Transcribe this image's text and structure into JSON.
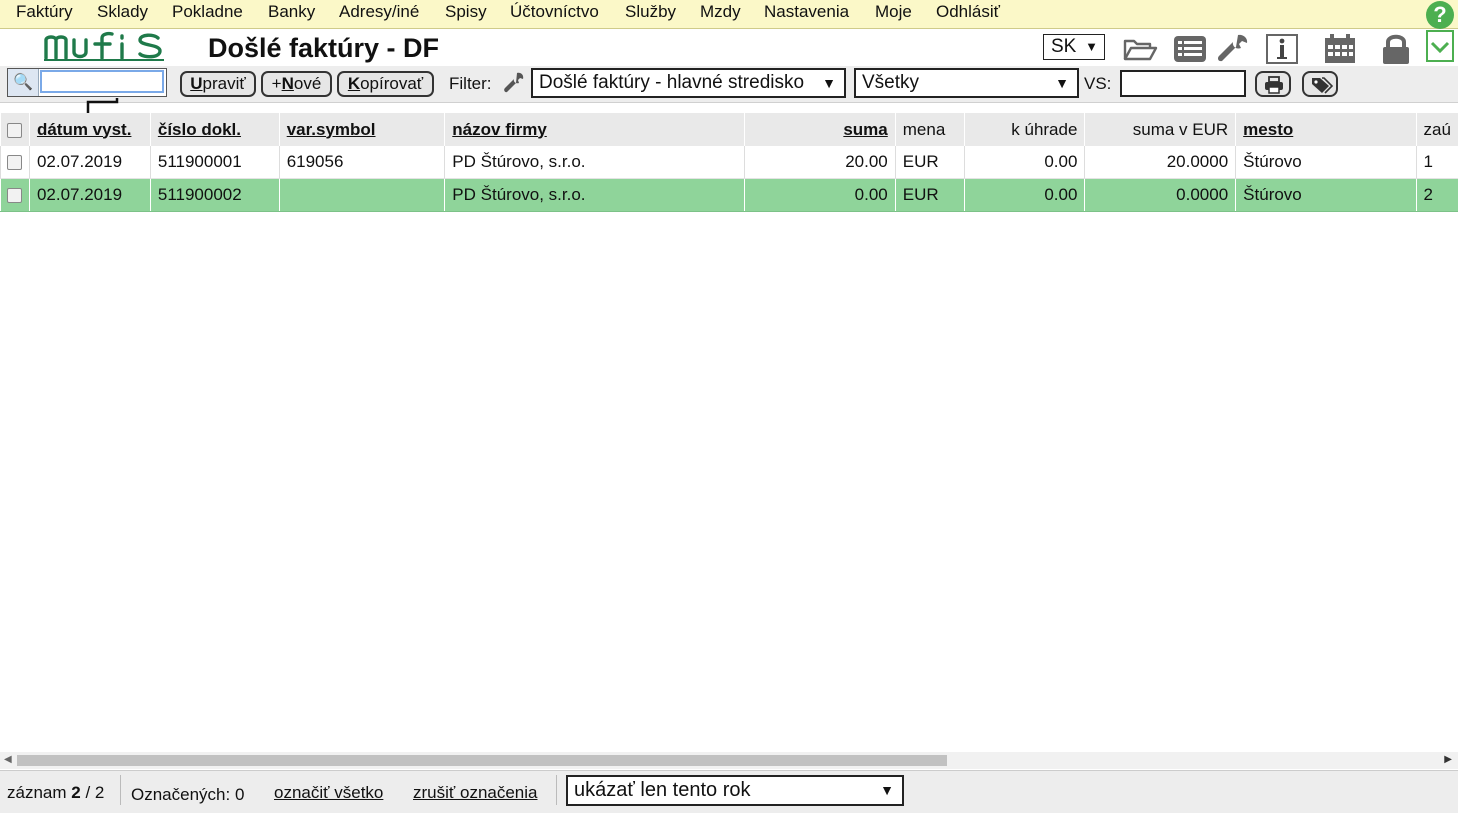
{
  "menu": {
    "items": [
      "Faktúry",
      "Sklady",
      "Pokladne",
      "Banky",
      "Adresy/iné",
      "Spisy",
      "Účtovníctvo",
      "Služby",
      "Mzdy",
      "Nastavenia",
      "Moje",
      "Odhlásiť"
    ],
    "help": "?"
  },
  "header": {
    "title": "Došlé faktúry - DF",
    "language": "SK",
    "icons": [
      "folder-icon",
      "list-icon",
      "wrench-icon",
      "info-icon",
      "calendar-icon",
      "lock-icon"
    ]
  },
  "toolbar": {
    "search_value": "",
    "edit_hotkey": "U",
    "edit_rest": "praviť",
    "new_prefix": "+",
    "new_hotkey": "N",
    "new_rest": "ové",
    "copy_hotkey": "K",
    "copy_rest": "opírovať",
    "filter_label": "Filter:",
    "filter_value": "Došlé faktúry - hlavné stredisko",
    "status_value": "Všetky",
    "vs_label": "VS:",
    "vs_value": "",
    "print_icon": "printer-icon",
    "tags_icon": "tags-icon"
  },
  "table": {
    "columns": [
      "dátum vyst.",
      "číslo dokl.",
      "var.symbol",
      "názov firmy",
      "suma",
      "mena",
      "k úhrade",
      "suma v EUR",
      "mesto",
      "zaú"
    ],
    "rows": [
      {
        "date": "02.07.2019",
        "doc": "511900001",
        "vs": "619056",
        "firm": "PD Štúrovo, s.r.o.",
        "sum": "20.00",
        "cur": "EUR",
        "due": "0.00",
        "eur": "20.0000",
        "city": "Štúrovo",
        "z": "1"
      },
      {
        "date": "02.07.2019",
        "doc": "511900002",
        "vs": "",
        "firm": "PD Štúrovo, s.r.o.",
        "sum": "0.00",
        "cur": "EUR",
        "due": "0.00",
        "eur": "0.0000",
        "city": "Štúrovo",
        "z": "2"
      }
    ],
    "selected_row": 2
  },
  "footer": {
    "record_label": "záznam",
    "record_current": "2",
    "record_total": "/ 2",
    "marked_label": "Označených: 0",
    "mark_all": "označiť všetko",
    "unmark": "zrušiť označenia",
    "year_filter": "ukázať len tento rok"
  },
  "colors": {
    "menubar_bg": "#fbf8c8",
    "selected_row": "#8fd49a",
    "brand_green": "#1f7a4a"
  }
}
